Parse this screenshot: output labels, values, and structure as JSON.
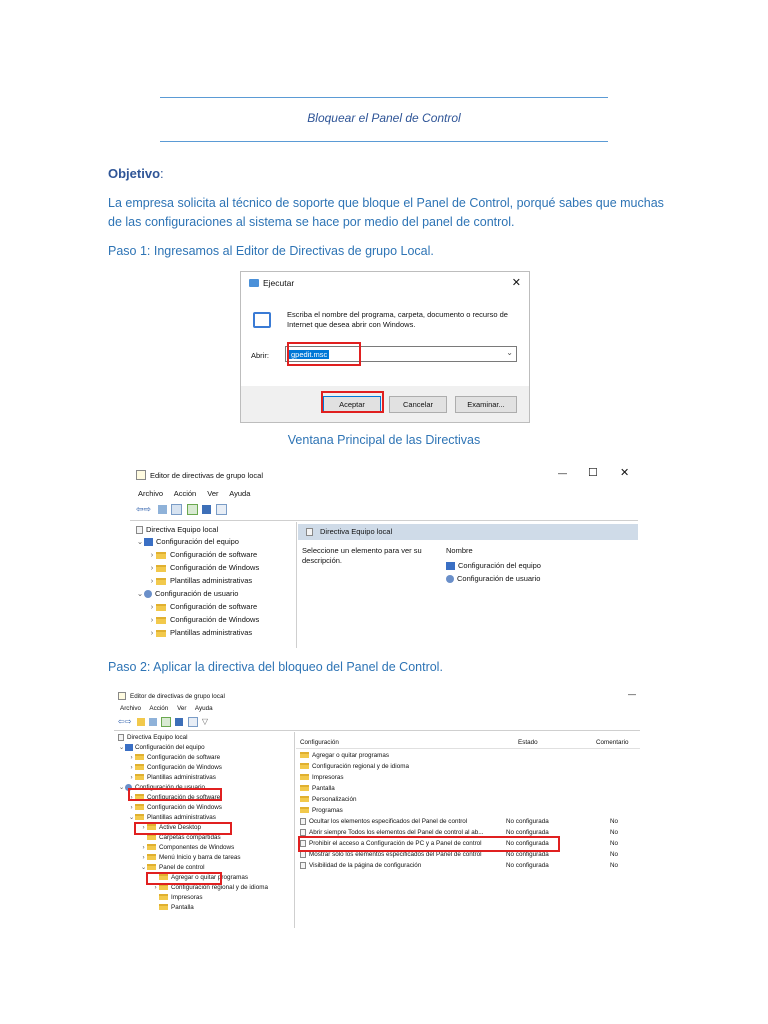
{
  "doc": {
    "title": "Bloquear el Panel de Control",
    "objective_heading": "Objetivo",
    "objective_text": "La empresa solicita al técnico de soporte que bloque el Panel de Control, porqué sabes que muchas de las configuraciones al sistema se hace por medio del panel de control.",
    "step1": "Paso 1: Ingresamos al Editor de Directivas de grupo Local.",
    "caption_main": "Ventana Principal de las Directivas",
    "step2": "Paso 2: Aplicar la directiva del bloqueo del Panel de Control."
  },
  "run_dialog": {
    "title": "Ejecutar",
    "close": "✕",
    "description": "Escriba el nombre del programa, carpeta, documento o recurso de Internet que desea abrir con Windows.",
    "open_label": "Abrir:",
    "open_value": "gpedit.msc",
    "ok": "Aceptar",
    "cancel": "Cancelar",
    "browse": "Examinar..."
  },
  "gpedit1": {
    "title": "Editor de directivas de grupo local",
    "minimize": "—",
    "maximize": "☐",
    "close": "✕",
    "menu": [
      "Archivo",
      "Acción",
      "Ver",
      "Ayuda"
    ],
    "tree": [
      {
        "label": "Directiva Equipo local",
        "depth": 0,
        "arrow": ""
      },
      {
        "label": "Configuración del equipo",
        "depth": 1,
        "arrow": "⌄"
      },
      {
        "label": "Configuración de software",
        "depth": 2,
        "arrow": "›"
      },
      {
        "label": "Configuración de Windows",
        "depth": 2,
        "arrow": "›"
      },
      {
        "label": "Plantillas administrativas",
        "depth": 2,
        "arrow": "›"
      },
      {
        "label": "Configuración de usuario",
        "depth": 1,
        "arrow": "⌄"
      },
      {
        "label": "Configuración de software",
        "depth": 2,
        "arrow": "›"
      },
      {
        "label": "Configuración de Windows",
        "depth": 2,
        "arrow": "›"
      },
      {
        "label": "Plantillas administrativas",
        "depth": 2,
        "arrow": "›"
      }
    ],
    "pane_title": "Directiva Equipo local",
    "pane_hint": "Seleccione un elemento para ver su descripción.",
    "name_header": "Nombre",
    "items": [
      "Configuración del equipo",
      "Configuración de usuario"
    ]
  },
  "gpedit2": {
    "title": "Editor de directivas de grupo local",
    "minimize": "—",
    "menu": [
      "Archivo",
      "Acción",
      "Ver",
      "Ayuda"
    ],
    "tree": [
      {
        "label": "Directiva Equipo local",
        "depth": 0,
        "arrow": ""
      },
      {
        "label": "Configuración del equipo",
        "depth": 1,
        "arrow": "⌄"
      },
      {
        "label": "Configuración de software",
        "depth": 2,
        "arrow": "›"
      },
      {
        "label": "Configuración de Windows",
        "depth": 2,
        "arrow": "›"
      },
      {
        "label": "Plantillas administrativas",
        "depth": 2,
        "arrow": "›"
      },
      {
        "label": "Configuración de usuario",
        "depth": 1,
        "arrow": "⌄"
      },
      {
        "label": "Configuración de software",
        "depth": 2,
        "arrow": "›"
      },
      {
        "label": "Configuración de Windows",
        "depth": 2,
        "arrow": "›"
      },
      {
        "label": "Plantillas administrativas",
        "depth": 2,
        "arrow": "⌄"
      },
      {
        "label": "Active Desktop",
        "depth": 3,
        "arrow": "›"
      },
      {
        "label": "Carpetas compartidas",
        "depth": 3,
        "arrow": ""
      },
      {
        "label": "Componentes de Windows",
        "depth": 3,
        "arrow": "›"
      },
      {
        "label": "Menú Inicio y barra de tareas",
        "depth": 3,
        "arrow": "›"
      },
      {
        "label": "Panel de control",
        "depth": 3,
        "arrow": "⌄"
      },
      {
        "label": "Agregar o quitar programas",
        "depth": 4,
        "arrow": ""
      },
      {
        "label": "Configuración regional y de idioma",
        "depth": 4,
        "arrow": "›"
      },
      {
        "label": "Impresoras",
        "depth": 4,
        "arrow": ""
      },
      {
        "label": "Pantalla",
        "depth": 4,
        "arrow": ""
      }
    ],
    "columns": [
      "Configuración",
      "Estado",
      "Comentario"
    ],
    "folders": [
      "Agregar o quitar programas",
      "Configuración regional y de idioma",
      "Impresoras",
      "Pantalla",
      "Personalización",
      "Programas"
    ],
    "policies": [
      {
        "name": "Ocultar los elementos especificados del Panel de control",
        "state": "No configurada",
        "comment": "No"
      },
      {
        "name": "Abrir siempre Todos los elementos del Panel de control al ab...",
        "state": "No configurada",
        "comment": "No"
      },
      {
        "name": "Prohibir el acceso a Configuración de PC y a Panel de control",
        "state": "No configurada",
        "comment": "No"
      },
      {
        "name": "Mostrar sólo los elementos especificados del Panel de control",
        "state": "No configurada",
        "comment": "No"
      },
      {
        "name": "Visibilidad de la página de configuración",
        "state": "No configurada",
        "comment": "No"
      }
    ]
  },
  "colors": {
    "heading": "#2f5597",
    "body": "#2e74b5",
    "highlight_box": "#e02020",
    "selection": "#0078d7"
  }
}
